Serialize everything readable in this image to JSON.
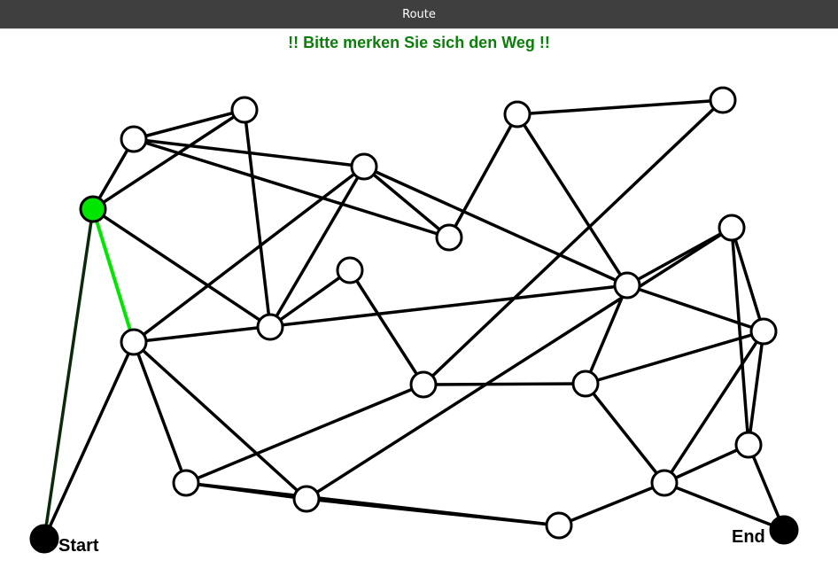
{
  "window": {
    "title": "Route"
  },
  "instruction": {
    "text": "!! Bitte merken Sie sich den Weg !!",
    "color": "#0a7f0a"
  },
  "colors": {
    "edge": "#000000",
    "node_fill": "#ffffff",
    "highlight": "#00e600",
    "start_end": "#000000"
  },
  "labels": {
    "start": "Start",
    "end": "End"
  },
  "graph": {
    "nodes": [
      "n1",
      "n2",
      "n3",
      "n4",
      "n5",
      "n6",
      "n7",
      "n8",
      "n9",
      "n10",
      "n11",
      "n12",
      "n13",
      "n14",
      "n15",
      "n16",
      "n17",
      "n18",
      "n19",
      "n20",
      "start",
      "end"
    ],
    "edges": [
      [
        "n1",
        "n2"
      ],
      [
        "n1",
        "n3"
      ],
      [
        "n1",
        "n4"
      ],
      [
        "n2",
        "n3"
      ],
      [
        "n2",
        "n5"
      ],
      [
        "n2",
        "n6"
      ],
      [
        "n3",
        "n4"
      ],
      [
        "n4",
        "n5"
      ],
      [
        "n4",
        "n10"
      ],
      [
        "n5",
        "n6"
      ],
      [
        "n5",
        "n12"
      ],
      [
        "n5",
        "n8"
      ],
      [
        "n6",
        "n7"
      ],
      [
        "n7",
        "n9"
      ],
      [
        "n7",
        "n12"
      ],
      [
        "n8",
        "n12"
      ],
      [
        "n8",
        "n15"
      ],
      [
        "n8",
        "n16"
      ],
      [
        "n9",
        "n11"
      ],
      [
        "n10",
        "n11"
      ],
      [
        "n11",
        "n15"
      ],
      [
        "n12",
        "n13"
      ],
      [
        "n12",
        "n14"
      ],
      [
        "n13",
        "n14"
      ],
      [
        "n13",
        "n16"
      ],
      [
        "n13",
        "n17"
      ],
      [
        "n14",
        "n19"
      ],
      [
        "n14",
        "n17"
      ],
      [
        "n15",
        "n16"
      ],
      [
        "n15",
        "n18"
      ],
      [
        "n16",
        "n18"
      ],
      [
        "n17",
        "n19"
      ],
      [
        "n17",
        "end"
      ],
      [
        "n18",
        "n19"
      ],
      [
        "n19",
        "end"
      ],
      [
        "start",
        "n3"
      ],
      [
        "start",
        "n8"
      ]
    ],
    "path": [
      [
        "n3",
        "n8"
      ]
    ],
    "current_node": "n3"
  }
}
